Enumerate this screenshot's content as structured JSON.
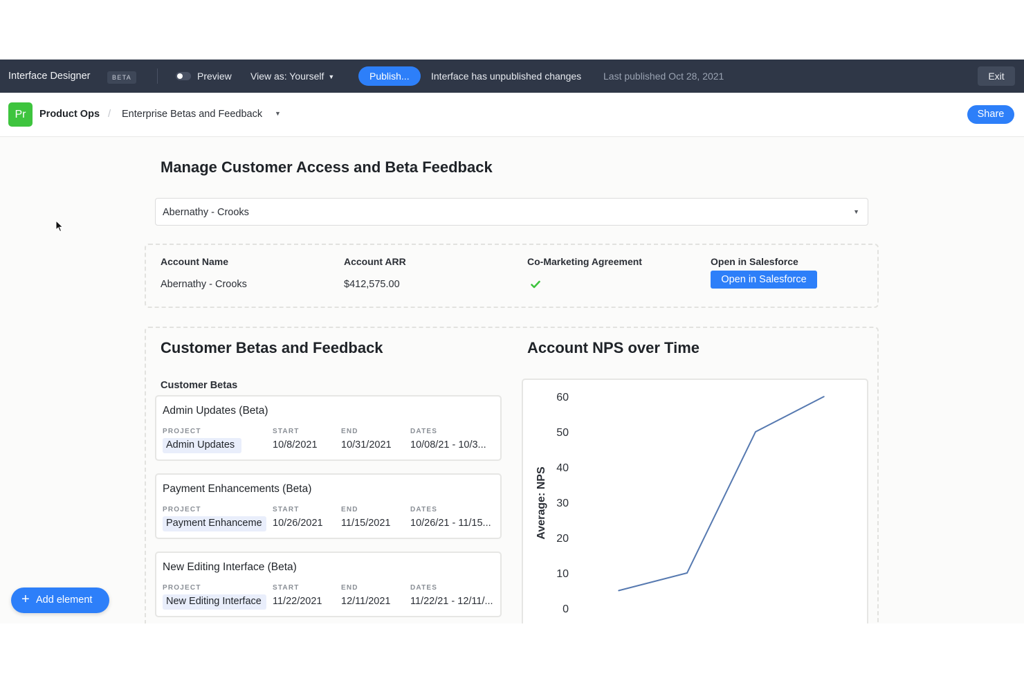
{
  "topbar": {
    "app_title": "Interface Designer",
    "beta_badge": "BETA",
    "preview_label": "Preview",
    "view_as_label": "View as: Yourself",
    "publish_label": "Publish...",
    "status_text": "Interface has unpublished changes",
    "last_published": "Last published Oct 28, 2021",
    "exit_label": "Exit"
  },
  "subbar": {
    "base_icon_text": "Pr",
    "base_icon_color": "#3ec43e",
    "base_name": "Product Ops",
    "separator": "/",
    "interface_name": "Enterprise Betas and Feedback",
    "share_label": "Share"
  },
  "main": {
    "title": "Manage Customer Access and Beta Feedback",
    "record_selector_value": "Abernathy - Crooks",
    "account": {
      "fields": [
        {
          "label": "Account Name",
          "value": "Abernathy - Crooks"
        },
        {
          "label": "Account ARR",
          "value": "$412,575.00"
        },
        {
          "label": "Co-Marketing Agreement",
          "value": "checked"
        },
        {
          "label": "Open in Salesforce",
          "button": "Open in Salesforce"
        }
      ]
    },
    "betas_section_title": "Customer Betas and Feedback",
    "betas_list_label": "Customer Betas",
    "meta_labels": {
      "project": "PROJECT",
      "start": "START",
      "end": "END",
      "dates": "DATES"
    },
    "betas": [
      {
        "title": "Admin Updates (Beta)",
        "project": "Admin Updates",
        "start": "10/8/2021",
        "end": "10/31/2021",
        "dates": "10/08/21 - 10/3..."
      },
      {
        "title": "Payment Enhancements (Beta)",
        "project": "Payment Enhanceme",
        "start": "10/26/2021",
        "end": "11/15/2021",
        "dates": "10/26/21 - 11/15..."
      },
      {
        "title": "New Editing Interface (Beta)",
        "project": "New Editing Interface",
        "start": "11/22/2021",
        "end": "12/11/2021",
        "dates": "11/22/21 - 12/11/..."
      }
    ],
    "nps_section_title": "Account NPS over Time",
    "add_element_label": "Add element"
  },
  "chart_data": {
    "type": "line",
    "title": "Account NPS over Time",
    "ylabel": "Average: NPS",
    "xlabel": "",
    "ylim": [
      0,
      60
    ],
    "yticks": [
      0,
      10,
      20,
      30,
      40,
      50,
      60
    ],
    "series": [
      {
        "values": [
          5,
          10,
          50,
          60
        ]
      }
    ],
    "line_color": "#5679b0"
  },
  "colors": {
    "accent": "#2d7ff9",
    "topbar_bg": "#2f3747",
    "check_green": "#3ec43e"
  }
}
